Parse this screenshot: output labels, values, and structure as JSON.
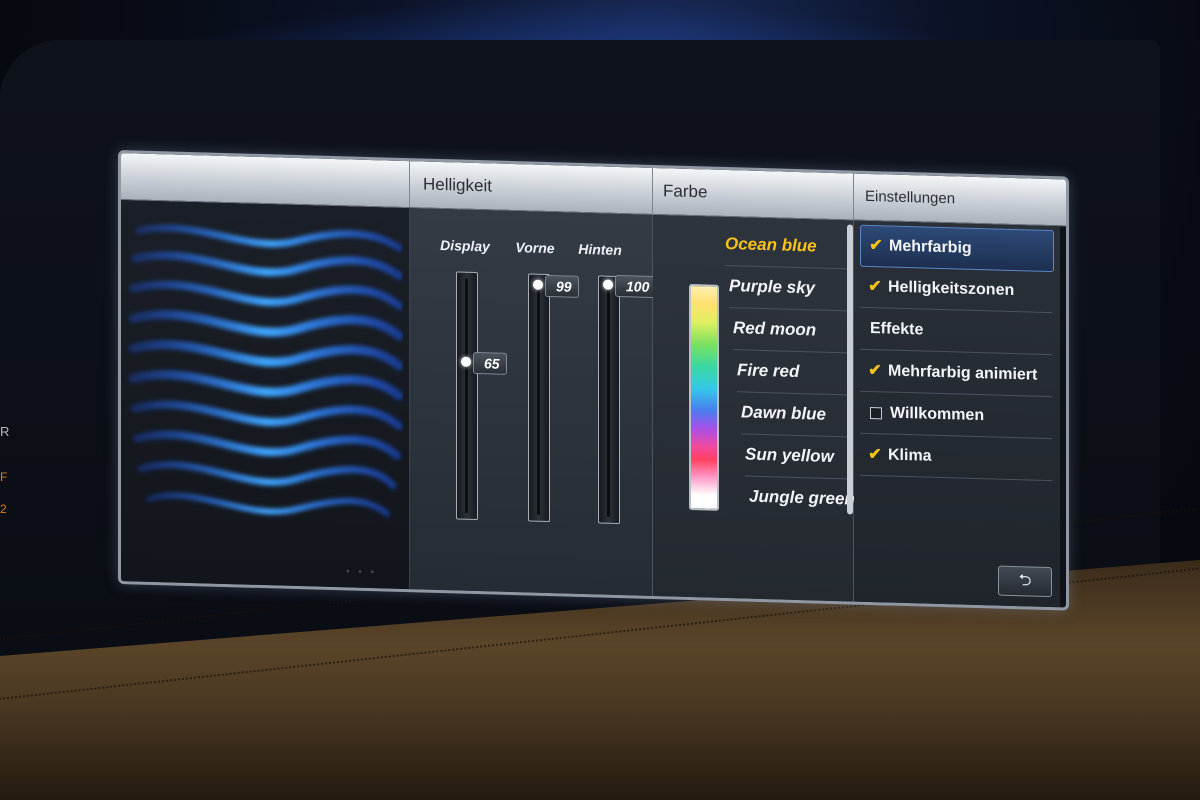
{
  "header": {
    "brightness_title": "Helligkeit",
    "color_title": "Farbe",
    "settings_title": "Einstellungen"
  },
  "brightness": {
    "sliders": [
      {
        "label": "Display",
        "value": "65",
        "level": 0.65
      },
      {
        "label": "Vorne",
        "value": "99",
        "level": 0.99
      },
      {
        "label": "Hinten",
        "value": "100",
        "level": 1.0
      }
    ]
  },
  "colors": {
    "items": [
      "Ocean blue",
      "Purple sky",
      "Red moon",
      "Fire red",
      "Dawn blue",
      "Sun yellow",
      "Jungle green"
    ],
    "selected": "Ocean blue",
    "accent": "#f7c21a"
  },
  "settings": {
    "items": [
      {
        "label": "Mehrfarbig",
        "checked": true
      },
      {
        "label": "Helligkeitszonen",
        "checked": true
      },
      {
        "label": "Effekte"
      },
      {
        "label": "Mehrfarbig animiert",
        "checked": true
      },
      {
        "label": "Willkommen",
        "checked": false
      },
      {
        "label": "Klima",
        "checked": true
      }
    ],
    "back_icon": "back-arrow-icon",
    "back_glyph": "⮌"
  },
  "side_labels": {
    "r": "R",
    "f": "F",
    "num": "2"
  }
}
